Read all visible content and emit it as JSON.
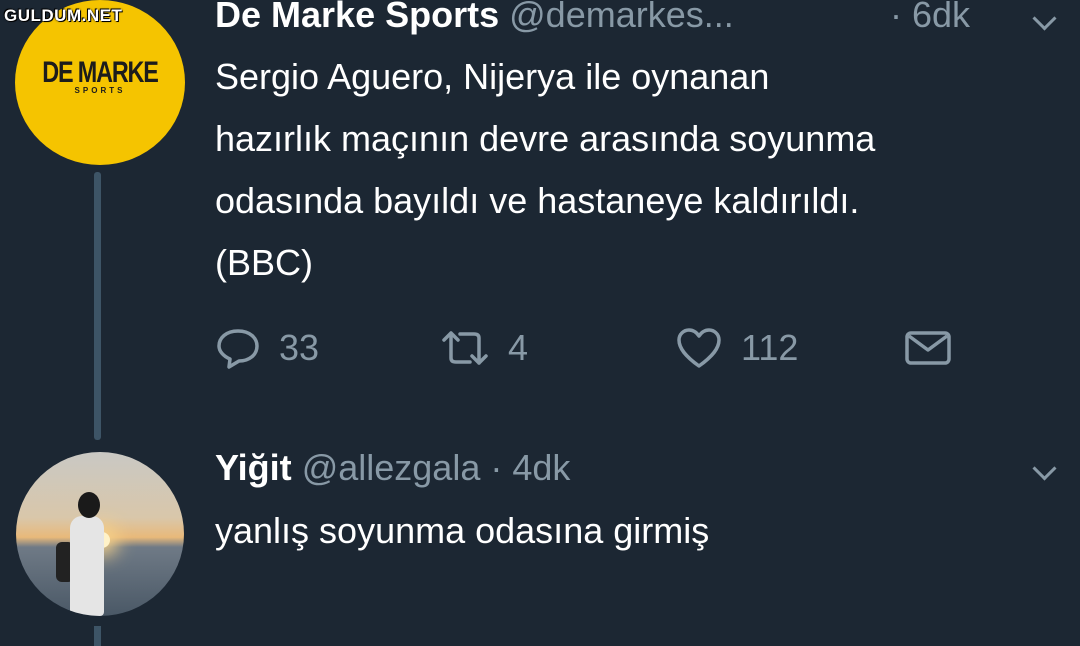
{
  "watermark": "GULDUM.NET",
  "tweet1": {
    "avatar_logo_main": "DE MARKE",
    "avatar_logo_sub": "SPORTS",
    "display_name": "De Marke Sports",
    "handle": "@demarkes...",
    "time": "· 6dk",
    "text_lines": [
      "Sergio Aguero, Nijerya ile oynanan",
      "hazırlık maçının devre arasında soyunma",
      "odasında bayıldı ve hastaneye kaldırıldı.",
      "(BBC)"
    ],
    "actions": {
      "reply_count": "33",
      "retweet_count": "4",
      "like_count": "112"
    },
    "icons": {
      "reply": "reply-icon",
      "retweet": "retweet-icon",
      "like": "heart-icon",
      "dm": "mail-icon",
      "more": "chevron-down-icon"
    }
  },
  "tweet2": {
    "display_name": "Yiğit",
    "handle": "@allezgala",
    "time": "· 4dk",
    "text": "yanlış soyunma odasına girmiş"
  },
  "colors": {
    "background": "#1c2733",
    "secondary_text": "#8899a6",
    "thread_line": "#3d5466",
    "brand_yellow": "#f5c400"
  }
}
